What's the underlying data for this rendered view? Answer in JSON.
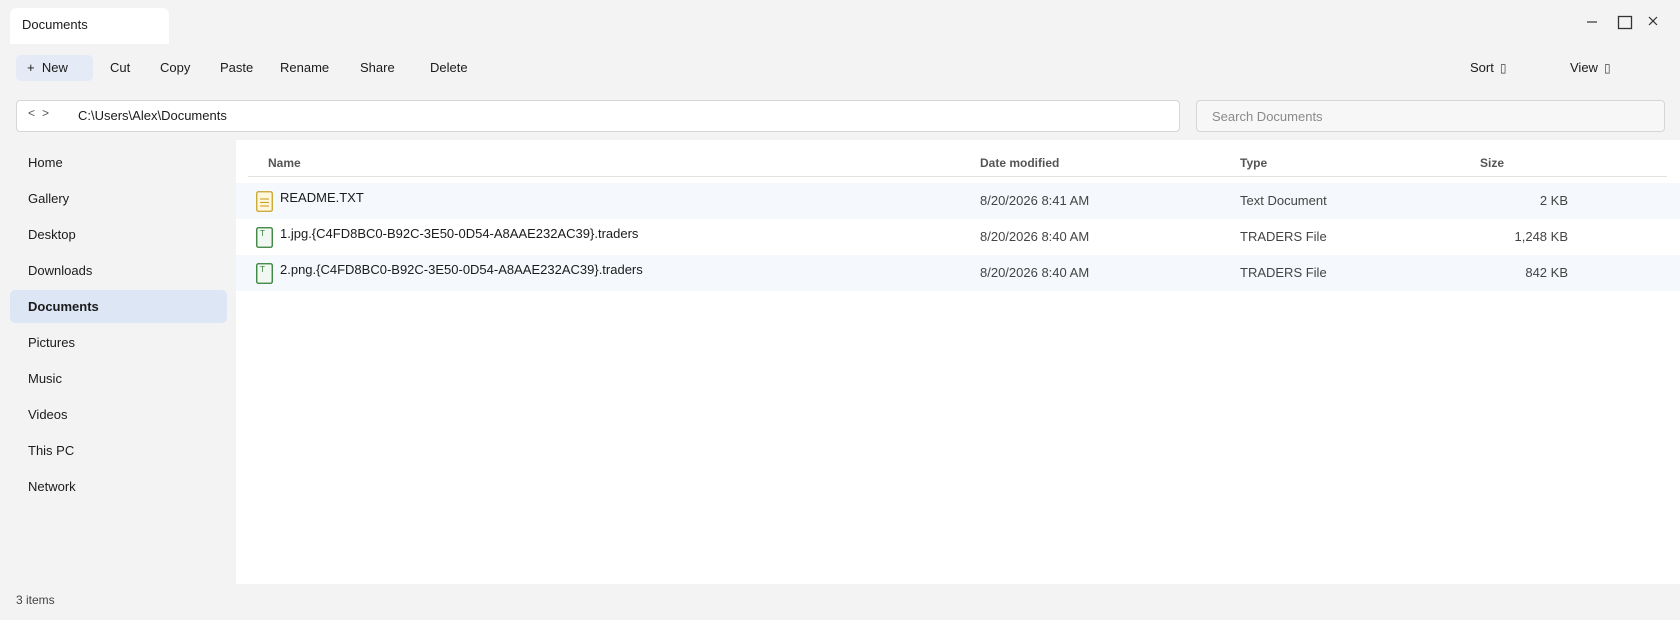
{
  "window": {
    "tab_title": "Documents",
    "controls": [
      "minimize-icon",
      "maximize-icon",
      "close-icon"
    ]
  },
  "toolbar": {
    "new_plus": "+",
    "new_label": "New",
    "cut_label": "Cut",
    "copy_label": "Copy",
    "paste_label": "Paste",
    "rename_label": "Rename",
    "share_label": "Share",
    "delete_label": "Delete",
    "sort_label": "Sort",
    "view_label": "View",
    "sort_glyph": "▯",
    "view_glyph": "▯"
  },
  "address": {
    "back_glyph": "<",
    "forward_glyph": ">",
    "path": "C:\\Users\\Alex\\Documents"
  },
  "search": {
    "placeholder": "Search Documents",
    "value": ""
  },
  "sidebar": {
    "items": [
      {
        "label": "Home"
      },
      {
        "label": "Gallery"
      },
      {
        "label": "Desktop"
      },
      {
        "label": "Downloads"
      },
      {
        "label": "Documents",
        "active": true
      },
      {
        "label": "Pictures"
      },
      {
        "label": "Music"
      },
      {
        "label": "Videos"
      },
      {
        "label": "This PC"
      },
      {
        "label": "Network"
      }
    ]
  },
  "list": {
    "columns": {
      "name": "Name",
      "date": "Date modified",
      "type": "Type",
      "size": "Size"
    },
    "rows": [
      {
        "icon": "text-document-icon",
        "name": "README.TXT",
        "date": "8/20/2026 8:41 AM",
        "type": "Text Document",
        "size": "2 KB"
      },
      {
        "icon": "traders-file-icon",
        "icon_letter": "T",
        "name": "1.jpg.{C4FD8BC0-B92C-3E50-0D54-A8AAE232AC39}.traders",
        "date": "8/20/2026 8:40 AM",
        "type": "TRADERS File",
        "size": "1,248 KB"
      },
      {
        "icon": "traders-file-icon",
        "icon_letter": "T",
        "name": "2.png.{C4FD8BC0-B92C-3E50-0D54-A8AAE232AC39}.traders",
        "date": "8/20/2026 8:40 AM",
        "type": "TRADERS File",
        "size": "842 KB"
      }
    ]
  },
  "status": {
    "item_count": "3 items"
  },
  "colors": {
    "accent": "#dce6f4",
    "new_button": "#e4ebf6",
    "text_icon": "#c9a227",
    "traders_icon": "#2e7d32"
  }
}
